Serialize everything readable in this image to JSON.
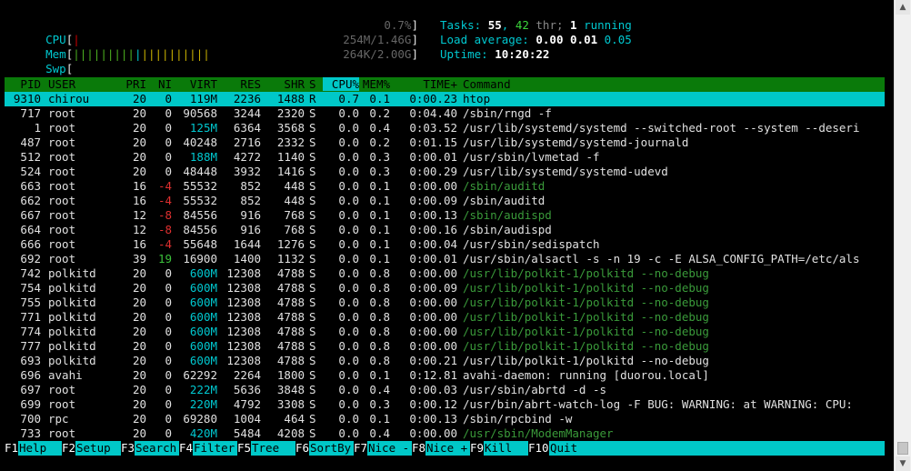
{
  "meters": {
    "cpu": {
      "label": "CPU",
      "value": "0.7%",
      "fraction": 0.007
    },
    "mem": {
      "label": "Mem",
      "value": "254M/1.46G",
      "fraction": 0.17
    },
    "swp": {
      "label": "Swp",
      "value": "264K/2.00G",
      "fraction": 0.0
    }
  },
  "summary": {
    "tasks_label": "Tasks:",
    "tasks": "55",
    "thr": "42",
    "thr_label": "thr;",
    "running": "1",
    "running_label": "running",
    "load_label": "Load average:",
    "load1": "0.00",
    "load5": "0.01",
    "load15": "0.05",
    "uptime_label": "Uptime:",
    "uptime": "10:20:22"
  },
  "columns": [
    "PID",
    "USER",
    "PRI",
    "NI",
    "VIRT",
    "RES",
    "SHR",
    "S",
    "CPU%",
    "MEM%",
    "TIME+",
    "Command"
  ],
  "processes": [
    {
      "pid": "9310",
      "user": "chirou",
      "pri": "20",
      "ni": "0",
      "virt": "119M",
      "res": "2236",
      "shr": "1488",
      "s": "R",
      "cpu": "0.7",
      "mem": "0.1",
      "time": "0:00.23",
      "cmd": "htop",
      "selected": true
    },
    {
      "pid": "717",
      "user": "root",
      "pri": "20",
      "ni": "0",
      "virt": "90568",
      "res": "3244",
      "shr": "2320",
      "s": "S",
      "cpu": "0.0",
      "mem": "0.2",
      "time": "0:04.40",
      "cmd": "/sbin/rngd -f"
    },
    {
      "pid": "1",
      "user": "root",
      "pri": "20",
      "ni": "0",
      "virt": "125M",
      "res": "6364",
      "shr": "3568",
      "s": "S",
      "cpu": "0.0",
      "mem": "0.4",
      "time": "0:03.52",
      "cmd": "/usr/lib/systemd/systemd --switched-root --system --deseri"
    },
    {
      "pid": "487",
      "user": "root",
      "pri": "20",
      "ni": "0",
      "virt": "40248",
      "res": "2716",
      "shr": "2332",
      "s": "S",
      "cpu": "0.0",
      "mem": "0.2",
      "time": "0:01.15",
      "cmd": "/usr/lib/systemd/systemd-journald"
    },
    {
      "pid": "512",
      "user": "root",
      "pri": "20",
      "ni": "0",
      "virt": "188M",
      "res": "4272",
      "shr": "1140",
      "s": "S",
      "cpu": "0.0",
      "mem": "0.3",
      "time": "0:00.01",
      "cmd": "/usr/sbin/lvmetad -f"
    },
    {
      "pid": "524",
      "user": "root",
      "pri": "20",
      "ni": "0",
      "virt": "48448",
      "res": "3932",
      "shr": "1416",
      "s": "S",
      "cpu": "0.0",
      "mem": "0.3",
      "time": "0:00.29",
      "cmd": "/usr/lib/systemd/systemd-udevd"
    },
    {
      "pid": "663",
      "user": "root",
      "pri": "16",
      "ni": "-4",
      "virt": "55532",
      "res": "852",
      "shr": "448",
      "s": "S",
      "cpu": "0.0",
      "mem": "0.1",
      "time": "0:00.00",
      "cmd": "/sbin/auditd",
      "thread": true
    },
    {
      "pid": "662",
      "user": "root",
      "pri": "16",
      "ni": "-4",
      "virt": "55532",
      "res": "852",
      "shr": "448",
      "s": "S",
      "cpu": "0.0",
      "mem": "0.1",
      "time": "0:00.09",
      "cmd": "/sbin/auditd"
    },
    {
      "pid": "667",
      "user": "root",
      "pri": "12",
      "ni": "-8",
      "virt": "84556",
      "res": "916",
      "shr": "768",
      "s": "S",
      "cpu": "0.0",
      "mem": "0.1",
      "time": "0:00.13",
      "cmd": "/sbin/audispd",
      "thread": true
    },
    {
      "pid": "664",
      "user": "root",
      "pri": "12",
      "ni": "-8",
      "virt": "84556",
      "res": "916",
      "shr": "768",
      "s": "S",
      "cpu": "0.0",
      "mem": "0.1",
      "time": "0:00.16",
      "cmd": "/sbin/audispd"
    },
    {
      "pid": "666",
      "user": "root",
      "pri": "16",
      "ni": "-4",
      "virt": "55648",
      "res": "1644",
      "shr": "1276",
      "s": "S",
      "cpu": "0.0",
      "mem": "0.1",
      "time": "0:00.04",
      "cmd": "/usr/sbin/sedispatch"
    },
    {
      "pid": "692",
      "user": "root",
      "pri": "39",
      "ni": "19",
      "virt": "16900",
      "res": "1400",
      "shr": "1132",
      "s": "S",
      "cpu": "0.0",
      "mem": "0.1",
      "time": "0:00.01",
      "cmd": "/usr/sbin/alsactl -s -n 19 -c -E ALSA_CONFIG_PATH=/etc/als"
    },
    {
      "pid": "742",
      "user": "polkitd",
      "pri": "20",
      "ni": "0",
      "virt": "600M",
      "res": "12308",
      "shr": "4788",
      "s": "S",
      "cpu": "0.0",
      "mem": "0.8",
      "time": "0:00.00",
      "cmd": "/usr/lib/polkit-1/polkitd --no-debug",
      "thread": true
    },
    {
      "pid": "754",
      "user": "polkitd",
      "pri": "20",
      "ni": "0",
      "virt": "600M",
      "res": "12308",
      "shr": "4788",
      "s": "S",
      "cpu": "0.0",
      "mem": "0.8",
      "time": "0:00.09",
      "cmd": "/usr/lib/polkit-1/polkitd --no-debug",
      "thread": true
    },
    {
      "pid": "755",
      "user": "polkitd",
      "pri": "20",
      "ni": "0",
      "virt": "600M",
      "res": "12308",
      "shr": "4788",
      "s": "S",
      "cpu": "0.0",
      "mem": "0.8",
      "time": "0:00.00",
      "cmd": "/usr/lib/polkit-1/polkitd --no-debug",
      "thread": true
    },
    {
      "pid": "771",
      "user": "polkitd",
      "pri": "20",
      "ni": "0",
      "virt": "600M",
      "res": "12308",
      "shr": "4788",
      "s": "S",
      "cpu": "0.0",
      "mem": "0.8",
      "time": "0:00.00",
      "cmd": "/usr/lib/polkit-1/polkitd --no-debug",
      "thread": true
    },
    {
      "pid": "774",
      "user": "polkitd",
      "pri": "20",
      "ni": "0",
      "virt": "600M",
      "res": "12308",
      "shr": "4788",
      "s": "S",
      "cpu": "0.0",
      "mem": "0.8",
      "time": "0:00.00",
      "cmd": "/usr/lib/polkit-1/polkitd --no-debug",
      "thread": true
    },
    {
      "pid": "777",
      "user": "polkitd",
      "pri": "20",
      "ni": "0",
      "virt": "600M",
      "res": "12308",
      "shr": "4788",
      "s": "S",
      "cpu": "0.0",
      "mem": "0.8",
      "time": "0:00.00",
      "cmd": "/usr/lib/polkit-1/polkitd --no-debug",
      "thread": true
    },
    {
      "pid": "693",
      "user": "polkitd",
      "pri": "20",
      "ni": "0",
      "virt": "600M",
      "res": "12308",
      "shr": "4788",
      "s": "S",
      "cpu": "0.0",
      "mem": "0.8",
      "time": "0:00.21",
      "cmd": "/usr/lib/polkit-1/polkitd --no-debug"
    },
    {
      "pid": "696",
      "user": "avahi",
      "pri": "20",
      "ni": "0",
      "virt": "62292",
      "res": "2264",
      "shr": "1800",
      "s": "S",
      "cpu": "0.0",
      "mem": "0.1",
      "time": "0:12.81",
      "cmd": "avahi-daemon: running [duorou.local]"
    },
    {
      "pid": "697",
      "user": "root",
      "pri": "20",
      "ni": "0",
      "virt": "222M",
      "res": "5636",
      "shr": "3848",
      "s": "S",
      "cpu": "0.0",
      "mem": "0.4",
      "time": "0:00.03",
      "cmd": "/usr/sbin/abrtd -d -s"
    },
    {
      "pid": "699",
      "user": "root",
      "pri": "20",
      "ni": "0",
      "virt": "220M",
      "res": "4792",
      "shr": "3308",
      "s": "S",
      "cpu": "0.0",
      "mem": "0.3",
      "time": "0:00.12",
      "cmd": "/usr/bin/abrt-watch-log -F BUG: WARNING: at WARNING: CPU:"
    },
    {
      "pid": "700",
      "user": "rpc",
      "pri": "20",
      "ni": "0",
      "virt": "69280",
      "res": "1004",
      "shr": "464",
      "s": "S",
      "cpu": "0.0",
      "mem": "0.1",
      "time": "0:00.13",
      "cmd": "/sbin/rpcbind -w"
    },
    {
      "pid": "733",
      "user": "root",
      "pri": "20",
      "ni": "0",
      "virt": "420M",
      "res": "5484",
      "shr": "4208",
      "s": "S",
      "cpu": "0.0",
      "mem": "0.4",
      "time": "0:00.00",
      "cmd": "/usr/sbin/ModemManager",
      "thread": true
    }
  ],
  "footer": [
    {
      "key": "F1",
      "label": "Help"
    },
    {
      "key": "F2",
      "label": "Setup"
    },
    {
      "key": "F3",
      "label": "Search"
    },
    {
      "key": "F4",
      "label": "Filter"
    },
    {
      "key": "F5",
      "label": "Tree"
    },
    {
      "key": "F6",
      "label": "SortBy"
    },
    {
      "key": "F7",
      "label": "Nice -"
    },
    {
      "key": "F8",
      "label": "Nice +"
    },
    {
      "key": "F9",
      "label": "Kill"
    },
    {
      "key": "F10",
      "label": "Quit"
    }
  ],
  "colors": {
    "cyan": "#00c8c8",
    "header_green": "#0a7a0a",
    "thread_green": "#3a9a3a",
    "negative_nice": "#e03030"
  }
}
